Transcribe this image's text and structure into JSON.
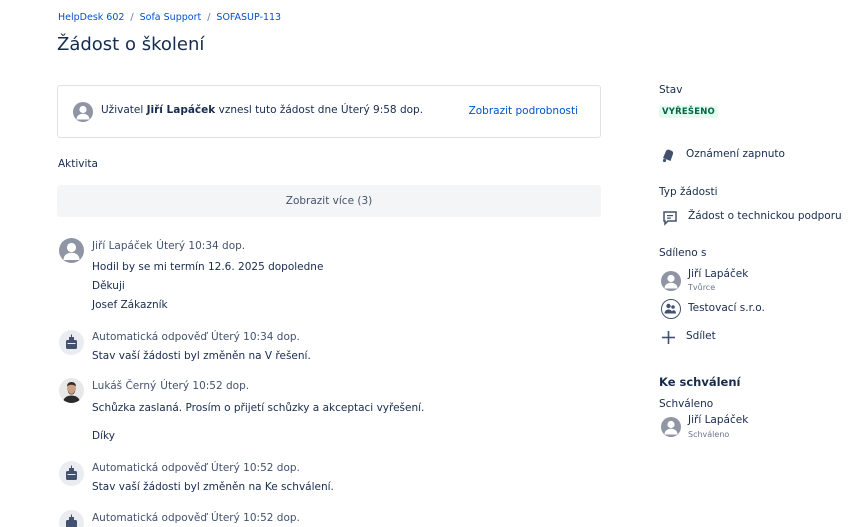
{
  "breadcrumb": {
    "project": "HelpDesk 602",
    "portal": "Sofa Support",
    "issue_key": "SOFASUP-113",
    "separator": "/"
  },
  "page_title": "Žádost o školení",
  "info": {
    "prefix": "Uživatel",
    "user": "Jiří Lapáček",
    "suffix": "vznesl tuto žádost dne Úterý 9:58 dop.",
    "details_link": "Zobrazit podrobnosti"
  },
  "activity": {
    "label": "Aktivita",
    "show_more": "Zobrazit více (3)",
    "items": [
      {
        "author": "Jiří Lapáček",
        "time": "Úterý 10:34 dop.",
        "avatar": "user-avatar-icon",
        "lines": [
          "Hodil by se mi termín 12.6. 2025 dopoledne",
          "Děkuji",
          "Josef Zákazník"
        ]
      },
      {
        "author": "Automatická odpověď",
        "time": "Úterý 10:34 dop.",
        "avatar": "robot-icon",
        "lines": [
          "Stav vaší žádosti byl změněn na V řešení."
        ]
      },
      {
        "author": "Lukáš Černý",
        "time": "Úterý 10:52 dop.",
        "avatar": "profile-photo",
        "lines": [
          "Schůzka zaslaná. Prosím o přijetí schůzky a akceptaci vyřešení.",
          "Díky"
        ]
      },
      {
        "author": "Automatická odpověď",
        "time": "Úterý 10:52 dop.",
        "avatar": "robot-icon",
        "lines": [
          "Stav vaší žádosti byl změněn na Ke schválení."
        ]
      },
      {
        "author": "Automatická odpověď",
        "time": "Úterý 10:52 dop.",
        "avatar": "robot-icon",
        "lines": []
      }
    ]
  },
  "sidebar": {
    "status_label": "Stav",
    "status_value": "VYŘEŠENO",
    "notifications": "Oznámení zapnuto",
    "request_type_label": "Typ žádosti",
    "request_type": "Žádost o technickou podporu",
    "shared_label": "Sdíleno s",
    "shared": [
      {
        "name": "Jiří Lapáček",
        "role": "Tvůrce"
      },
      {
        "name": "Testovací s.r.o.",
        "role": ""
      }
    ],
    "share_button": "Sdílet",
    "approval_heading": "Ke schválení",
    "approved_label": "Schváleno",
    "approver_name": "Jiří Lapáček",
    "approver_status": "Schváleno"
  },
  "colors": {
    "link": "#0052cc",
    "status_bg": "#e3fcef",
    "status_fg": "#006644"
  }
}
